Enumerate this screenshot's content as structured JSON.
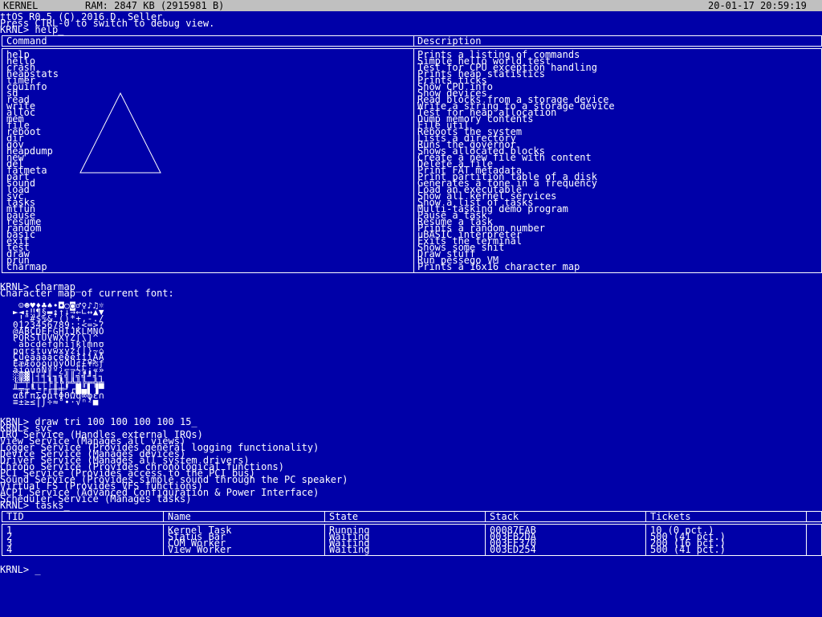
{
  "status_bar": {
    "title": "KERNEL",
    "ram": "RAM: 2847 KB (2915981 B)",
    "datetime": "20-01-17 20:59:19"
  },
  "console": {
    "boot_line_1": "ttOS R0.5 (C) 2016 D. Seller",
    "boot_line_2": "Press CTRL-0 to switch to debug view.",
    "prompt_help": "KRNL> help_",
    "prompt_charmap": "KRNL> charmap_",
    "charmap_caption": "Character map of current font:",
    "prompt_draw": "KRNL> draw tri 100 100 100 100 15_",
    "prompt_svc": "KRNL> svc_",
    "prompt_tasks": "KRNL> tasks_",
    "prompt_current": "KRNL> _"
  },
  "help_table": {
    "col_command": "Command",
    "col_description": "Description",
    "rows": [
      {
        "cmd": "help",
        "desc": "Prints a listing of commands"
      },
      {
        "cmd": "hello",
        "desc": "Simple hello world test"
      },
      {
        "cmd": "crash",
        "desc": "Test for CPU exception handling"
      },
      {
        "cmd": "heapstats",
        "desc": "Prints heap statistics"
      },
      {
        "cmd": "timer",
        "desc": "Prints ticks"
      },
      {
        "cmd": "cpuinfo",
        "desc": "Show CPU info"
      },
      {
        "cmd": "sd",
        "desc": "Show devices"
      },
      {
        "cmd": "read",
        "desc": "Read blocks from a storage device"
      },
      {
        "cmd": "write",
        "desc": "Write a string to a storage device"
      },
      {
        "cmd": "alloc",
        "desc": "Test for heap allocation"
      },
      {
        "cmd": "mem",
        "desc": "Dump memory contents"
      },
      {
        "cmd": "file",
        "desc": "File util"
      },
      {
        "cmd": "reboot",
        "desc": "Reboots the system"
      },
      {
        "cmd": "dir",
        "desc": "Lists a directory"
      },
      {
        "cmd": "gov",
        "desc": "Runs the governor"
      },
      {
        "cmd": "heapdump",
        "desc": "Shows allocated blocks"
      },
      {
        "cmd": "new",
        "desc": "Create a new file with content"
      },
      {
        "cmd": "del",
        "desc": "Delete a file"
      },
      {
        "cmd": "fatmeta",
        "desc": "Print FAT metadata"
      },
      {
        "cmd": "part",
        "desc": "Print partition table of a disk"
      },
      {
        "cmd": "sound",
        "desc": "Generates a tone in a frequency"
      },
      {
        "cmd": "load",
        "desc": "Load an executable"
      },
      {
        "cmd": "svc",
        "desc": "Show all kernel services"
      },
      {
        "cmd": "tasks",
        "desc": "Show a list of tasks"
      },
      {
        "cmd": "mtfun",
        "desc": "Multi-tasking demo program"
      },
      {
        "cmd": "pause",
        "desc": "Pause a task"
      },
      {
        "cmd": "resume",
        "desc": "Resume a task"
      },
      {
        "cmd": "random",
        "desc": "Prints a random number"
      },
      {
        "cmd": "basic",
        "desc": "uBASIC interpreter"
      },
      {
        "cmd": "exit",
        "desc": "Exits the terminal"
      },
      {
        "cmd": "test",
        "desc": "Shows some shit"
      },
      {
        "cmd": "draw",
        "desc": "Draw stuff"
      },
      {
        "cmd": "prun",
        "desc": "Run pessego VM"
      },
      {
        "cmd": "charmap",
        "desc": "Prints a 16x16 character map"
      }
    ]
  },
  "charmap_rows": [
    " ☺☻♥♦♣♠•◘○◙♂♀♪♫☼",
    "►◄↕‼¶§▬↨↑↓→←∟↔▲▼",
    " !\"#$%&'()*+,-./",
    "0123456789:;<=>?",
    "@ABCDEFGHIJKLMNO",
    "PQRSTUVWXYZ[\\]^_",
    "`abcdefghijklmno",
    "pqrstuvwxyz{|}~⌂",
    "ÇüéâäàåçêëèïîìÄÅ",
    "ÉæÆôöòûùÿÖÜ¢£¥₧ƒ",
    "áíóúñÑªº¿⌐¬½¼¡«»",
    "░▒▓│┤╡╢╖╕╣║╗╝╜╛┐",
    "└┴┬├─┼╞╟╚╔╩╦╠═╬╧",
    "╨╤╥╙╘╒╓╫╪┘┌█▄▌▐▀",
    "αßΓπΣσµτΦΘΩδ∞φε∩",
    "≡±≥≤⌠⌡÷≈°∙·√ⁿ²■ "
  ],
  "services": [
    "IRQ Service (Handles external IRQs)",
    "View Service (Manages all views)",
    "Logger Service (Provides general logging functionality)",
    "Device Service (Manages devices)",
    "Driver Service (Manages all system drivers)",
    "Chrono Service (Provides chronological functions)",
    "PCI Service (Provides access to the PCI bus)",
    "Sound Service (Provides simple sound through the PC speaker)",
    "Virtual FS (Provides VFS functions)",
    "ACPI Service (Advanced Configuration & Power Interface)",
    "Scheduler Service (Manages tasks)"
  ],
  "tasks_table": {
    "columns": [
      "TID",
      "Name",
      "State",
      "Stack",
      "Tickets"
    ],
    "rows": [
      {
        "tid": "1",
        "name": "Kernel Task",
        "state": "Running",
        "stack": "00087EAB",
        "tickets": "10 (0 pct.)"
      },
      {
        "tid": "2",
        "name": "Status Bar",
        "state": "Waiting",
        "stack": "003EB2DA",
        "tickets": "500 (41 pct.)"
      },
      {
        "tid": "3",
        "name": "COM Worker",
        "state": "Waiting",
        "stack": "003EF370",
        "tickets": "200 (16 pct.)"
      },
      {
        "tid": "4",
        "name": "View Worker",
        "state": "Waiting",
        "stack": "003ED254",
        "tickets": "500 (41 pct.)"
      }
    ]
  },
  "colors": {
    "background": "#0000a8",
    "foreground": "#ffffff",
    "status_bar": "#c0c0c0"
  }
}
